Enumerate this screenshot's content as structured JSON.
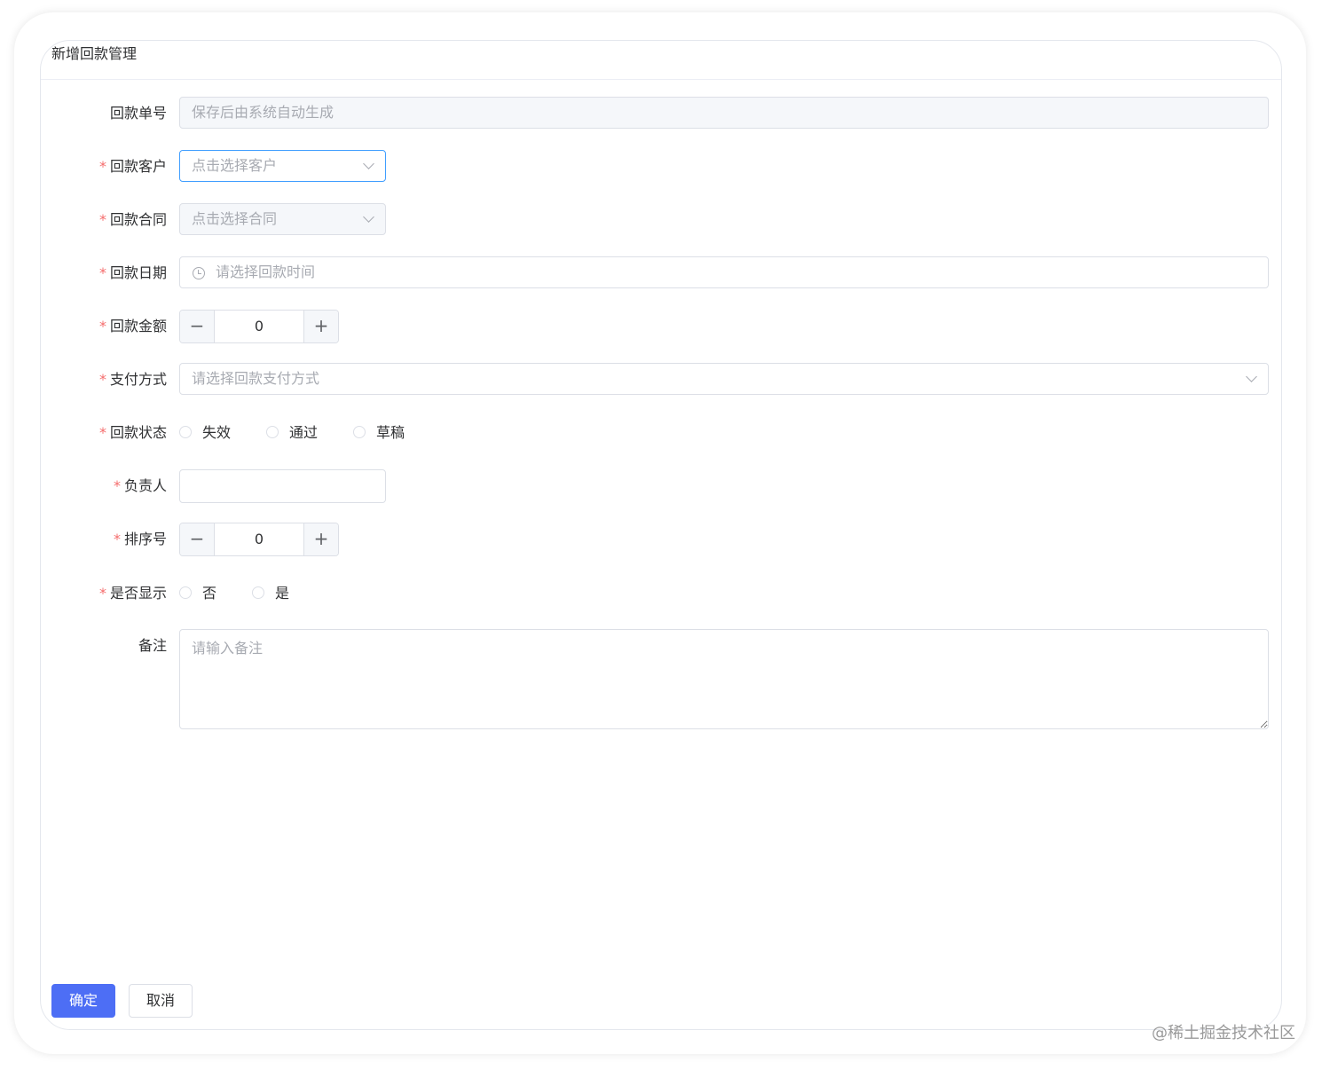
{
  "dialog": {
    "title": "新增回款管理"
  },
  "form": {
    "code": {
      "label": "回款单号",
      "placeholder": "保存后由系统自动生成",
      "required": false
    },
    "customer": {
      "label": "回款客户",
      "placeholder": "点击选择客户",
      "required": true
    },
    "contract": {
      "label": "回款合同",
      "placeholder": "点击选择合同",
      "required": true
    },
    "date": {
      "label": "回款日期",
      "placeholder": "请选择回款时间",
      "required": true
    },
    "amount": {
      "label": "回款金额",
      "value": "0",
      "required": true
    },
    "payment": {
      "label": "支付方式",
      "placeholder": "请选择回款支付方式",
      "required": true
    },
    "status": {
      "label": "回款状态",
      "required": true,
      "options": [
        "失效",
        "通过",
        "草稿"
      ]
    },
    "owner": {
      "label": "负责人",
      "value": "",
      "required": true
    },
    "sort": {
      "label": "排序号",
      "value": "0",
      "required": true
    },
    "show": {
      "label": "是否显示",
      "required": true,
      "options": [
        "否",
        "是"
      ]
    },
    "remark": {
      "label": "备注",
      "placeholder": "请输入备注",
      "required": false
    },
    "required_mark": "*"
  },
  "footer": {
    "confirm_label": "确定",
    "cancel_label": "取消"
  },
  "watermark": "@稀土掘金技术社区",
  "colors": {
    "primary": "#4d6ef5",
    "required": "#f56c6c",
    "focus_border": "#409eff"
  }
}
